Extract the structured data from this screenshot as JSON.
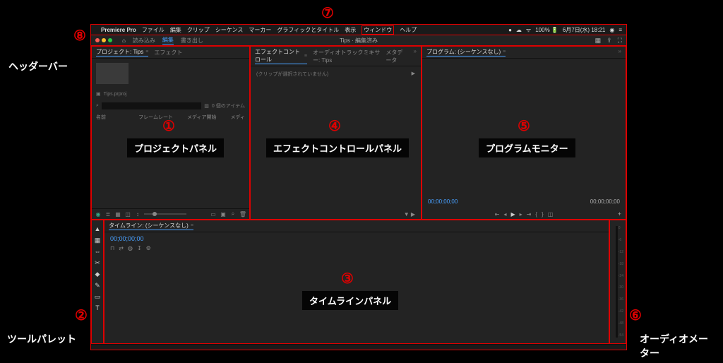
{
  "menubar": {
    "app_name": "Premiere Pro",
    "items": [
      "ファイル",
      "編集",
      "クリップ",
      "シーケンス",
      "マーカー",
      "グラフィックとタイトル",
      "表示",
      "ウィンドウ",
      "ヘルプ"
    ],
    "battery": "100% 🔋",
    "clock": "6月7日(水) 18:21"
  },
  "header": {
    "home_icon": "home",
    "tabs": [
      "読み込み",
      "編集",
      "書き出し"
    ],
    "active_tab": "編集",
    "center_title": "Tips · 編集済み",
    "right_icons": [
      "workspace-icon",
      "export-icon",
      "settings-icon"
    ]
  },
  "panels": {
    "project": {
      "tabs": [
        "プロジェクト: Tips",
        "エフェクト"
      ],
      "active": 0,
      "bin_label": "Tips.prproj",
      "search_icon": "search",
      "search_placeholder": "",
      "item_count": "0 個のアイテム",
      "cols": [
        "名前",
        "フレームレート",
        "メディア開始",
        "メディ"
      ],
      "bottom_icons": [
        "list-view",
        "thumb-view",
        "freeform",
        "sort",
        "new-bin",
        "new-item",
        "search",
        "trash"
      ]
    },
    "effect_ctrl": {
      "tabs": [
        "エフェクトコントロール",
        "オーディオトラックミキサー: Tips",
        "メタデータ"
      ],
      "active": 0,
      "msg": "(クリップが選択されていません)"
    },
    "program": {
      "tab": "プログラム: (シーケンスなし)",
      "time_start": "00;00;00;00",
      "time_end": "00;00;00;00"
    },
    "timeline": {
      "tab": "タイムライン: (シーケンスなし)",
      "time": "00;00;00;00",
      "btn_icons": [
        "snap",
        "link",
        "marker",
        "ripple",
        "wrench"
      ]
    },
    "tools": [
      "▲",
      "▦",
      "⇔",
      "✂",
      "◆",
      "✎",
      "▭",
      "T"
    ],
    "meter_ticks": [
      "0",
      "-6",
      "-12",
      "-18",
      "-24",
      "-30",
      "-36",
      "-42",
      "-48",
      "-54"
    ]
  },
  "callouts": {
    "n1": "①",
    "l1": "プロジェクトパネル",
    "n2": "②",
    "l2": "ツールパレット",
    "n3": "③",
    "l3": "タイムラインパネル",
    "n4": "④",
    "l4": "エフェクトコントロールパネル",
    "n5": "⑤",
    "l5": "プログラムモニター",
    "n6": "⑥",
    "l6": "オーディオメーター",
    "n7": "⑦",
    "n8": "⑧",
    "l8": "ヘッダーバー"
  }
}
